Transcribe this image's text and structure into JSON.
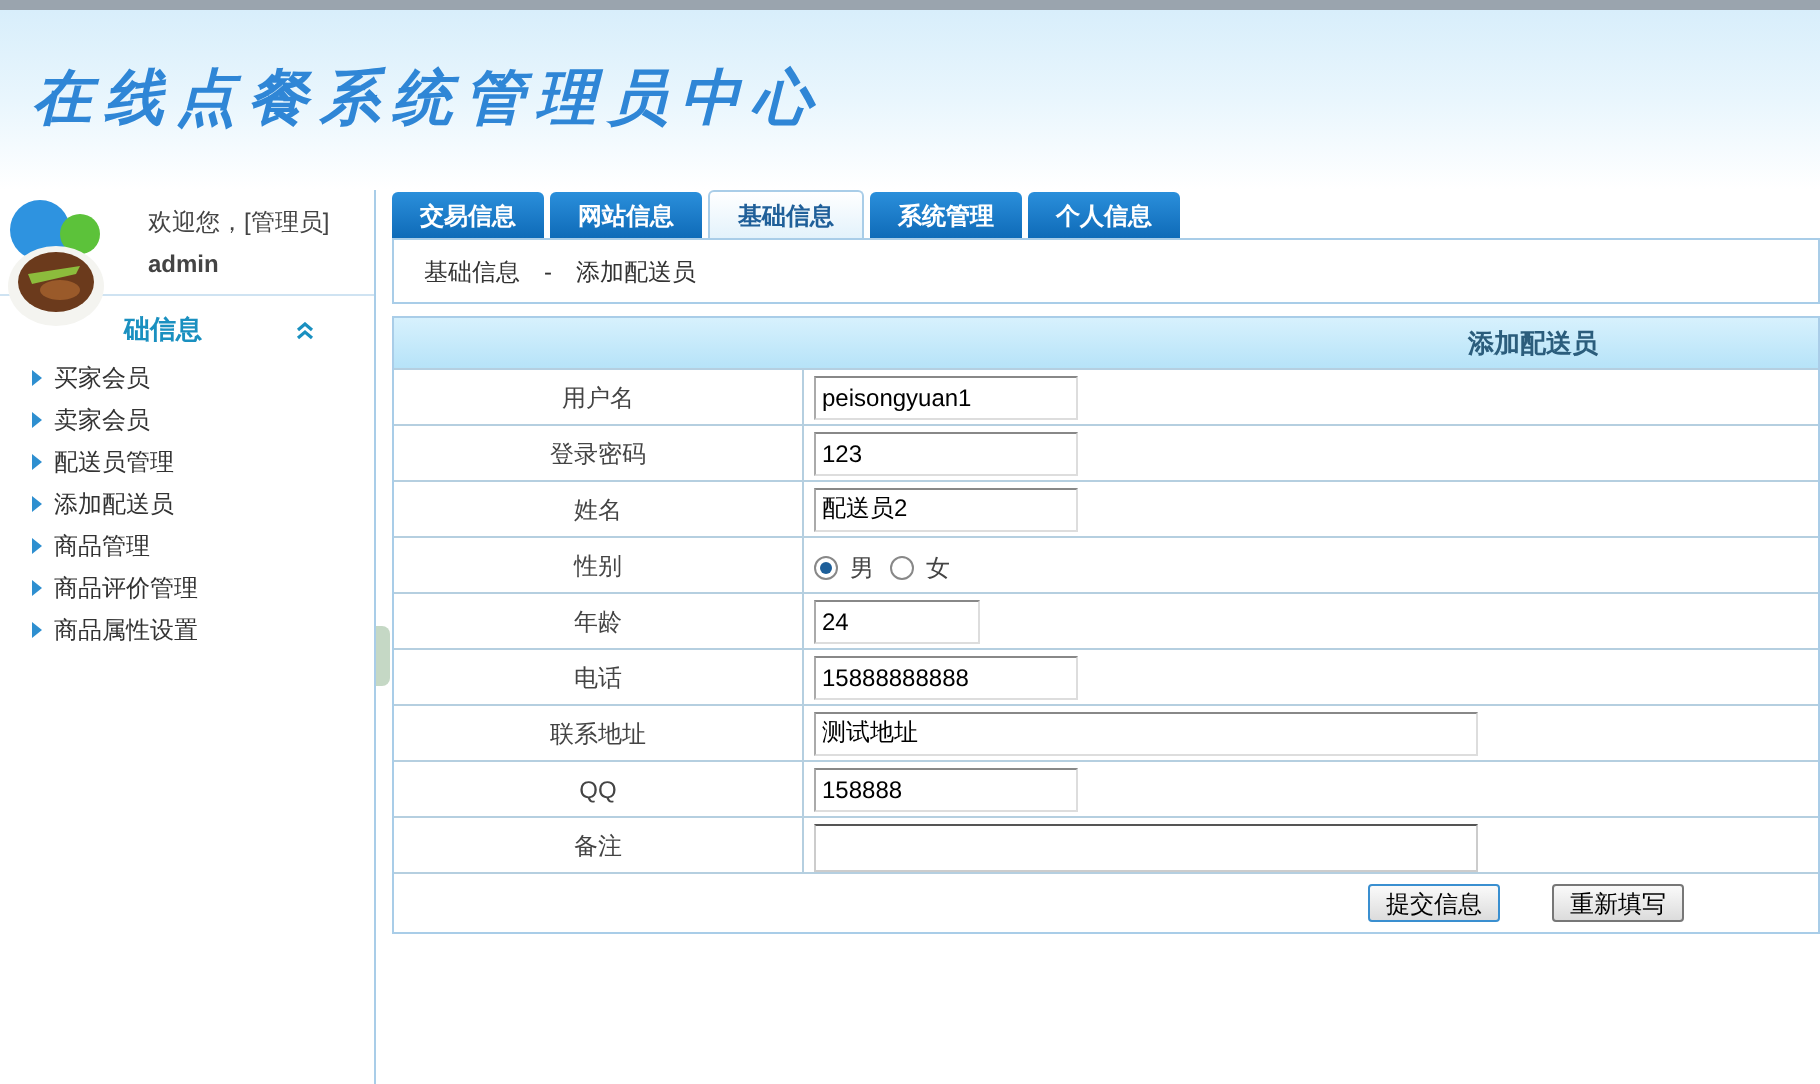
{
  "header": {
    "title": "在线点餐系统管理员中心"
  },
  "sidebar": {
    "welcome": "欢迎您，[管理员]",
    "user": "admin",
    "section": {
      "title": "础信息",
      "expanded": true
    },
    "items": [
      "买家会员",
      "卖家会员",
      "配送员管理",
      "添加配送员",
      "商品管理",
      "商品评价管理",
      "商品属性设置"
    ]
  },
  "tabs": [
    {
      "label": "交易信息",
      "selected": false
    },
    {
      "label": "网站信息",
      "selected": false
    },
    {
      "label": "基础信息",
      "selected": true
    },
    {
      "label": "系统管理",
      "selected": false
    },
    {
      "label": "个人信息",
      "selected": false
    }
  ],
  "breadcrumb": {
    "section": "基础信息",
    "separator": "-",
    "page": "添加配送员"
  },
  "form": {
    "title": "添加配送员",
    "rows": [
      {
        "kind": "text",
        "label": "用户名",
        "value": "peisongyuan1"
      },
      {
        "kind": "text",
        "label": "登录密码",
        "value": "123"
      },
      {
        "kind": "text",
        "label": "姓名",
        "value": "配送员2"
      },
      {
        "kind": "radio",
        "label": "性别",
        "options": [
          {
            "label": "男",
            "selected": true
          },
          {
            "label": "女",
            "selected": false
          }
        ]
      },
      {
        "kind": "short_text",
        "label": "年龄",
        "value": "24"
      },
      {
        "kind": "text",
        "label": "电话",
        "value": "15888888888"
      },
      {
        "kind": "long_text",
        "label": "联系地址",
        "value": "测试地址"
      },
      {
        "kind": "text",
        "label": "QQ",
        "value": "158888"
      },
      {
        "kind": "textarea",
        "label": "备注",
        "value": ""
      }
    ],
    "buttons": [
      "提交信息",
      "重新填写"
    ]
  }
}
